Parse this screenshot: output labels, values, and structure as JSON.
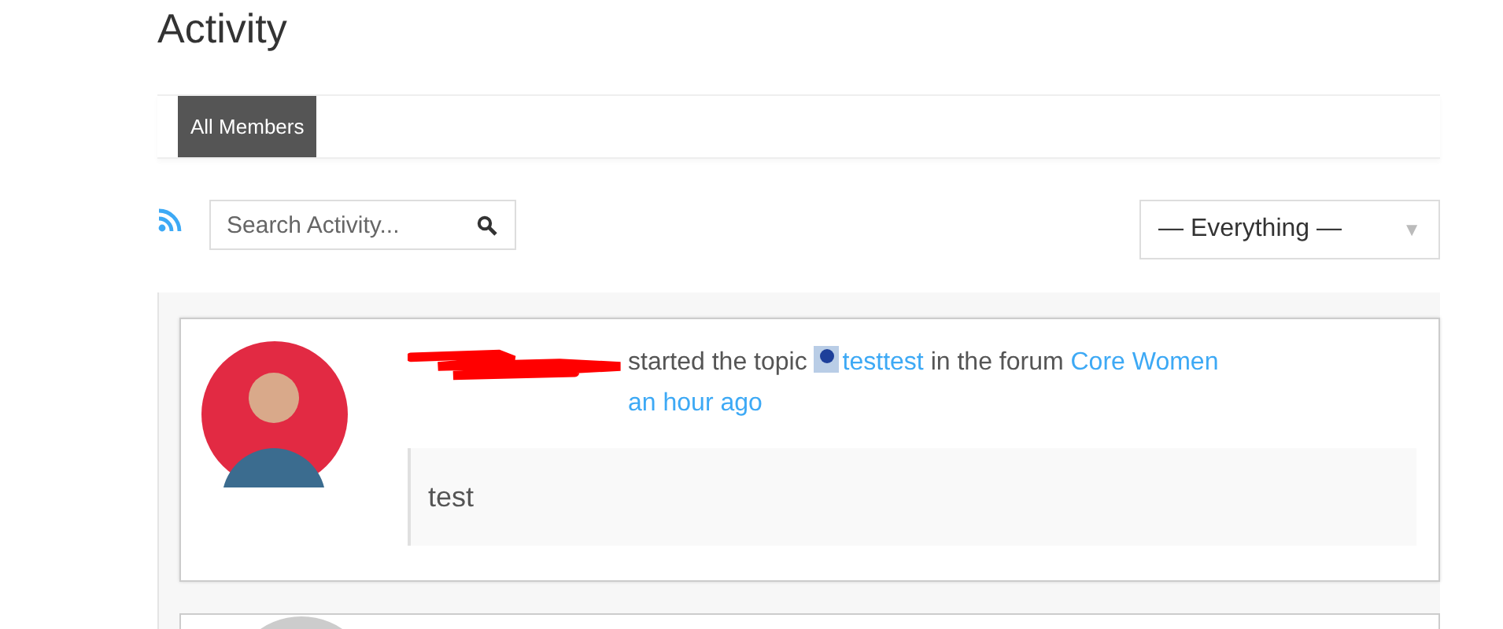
{
  "page_title": "Activity",
  "tabs": [
    {
      "label": "All Members",
      "selected": true
    }
  ],
  "search": {
    "placeholder": "Search Activity..."
  },
  "filter": {
    "value": "— Everything —",
    "caret": "▼"
  },
  "activities": [
    {
      "action": " started the topic ",
      "topic": "testtest",
      "middle": " in the forum ",
      "forum": "Core Women",
      "time": "an hour ago",
      "excerpt": "test"
    }
  ]
}
